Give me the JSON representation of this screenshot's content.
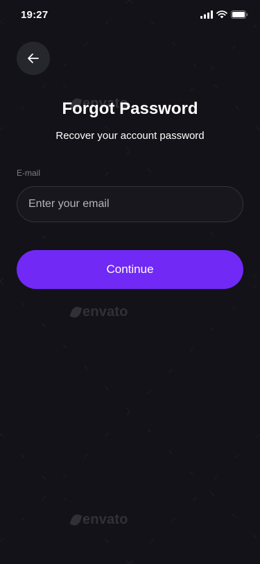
{
  "status_bar": {
    "time": "19:27"
  },
  "header": {
    "back_icon": "arrow-left-icon",
    "title": "Forgot Password",
    "subtitle": "Recover your account password"
  },
  "form": {
    "email_label": "E-mail",
    "email_placeholder": "Enter your email",
    "email_value": ""
  },
  "actions": {
    "continue_label": "Continue"
  },
  "watermark": {
    "text": "envato"
  },
  "colors": {
    "background": "#121218",
    "accent": "#7129f6",
    "input_border": "#34343b",
    "back_button_bg": "#26262d",
    "label_text": "#7d7d86"
  }
}
